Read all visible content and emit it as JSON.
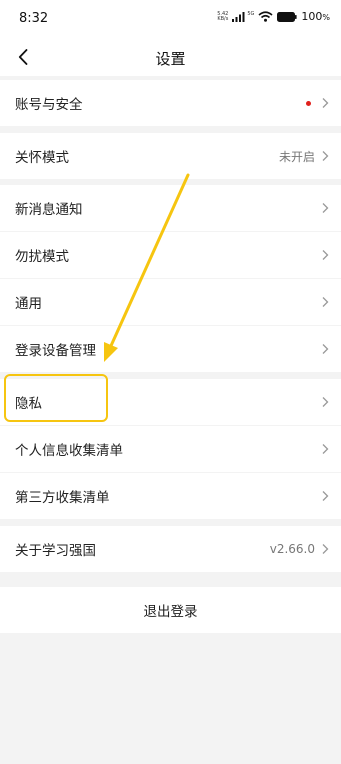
{
  "status_bar": {
    "time": "8:32",
    "net_speed": "5.42 KB/s",
    "signal": "5G",
    "battery": "100"
  },
  "nav": {
    "title": "设置"
  },
  "rows": [
    {
      "label": "账号与安全",
      "value": "",
      "has_dot": true
    },
    {
      "label": "关怀模式",
      "value": "未开启"
    },
    {
      "label": "新消息通知",
      "value": ""
    },
    {
      "label": "勿扰模式",
      "value": ""
    },
    {
      "label": "通用",
      "value": ""
    },
    {
      "label": "登录设备管理",
      "value": ""
    },
    {
      "label": "隐私",
      "value": ""
    },
    {
      "label": "个人信息收集清单",
      "value": ""
    },
    {
      "label": "第三方收集清单",
      "value": ""
    },
    {
      "label": "关于学习强国",
      "value": "v2.66.0"
    }
  ],
  "logout": {
    "label": "退出登录"
  },
  "colors": {
    "annotation": "#f6c510",
    "dot": "#e0201c"
  }
}
